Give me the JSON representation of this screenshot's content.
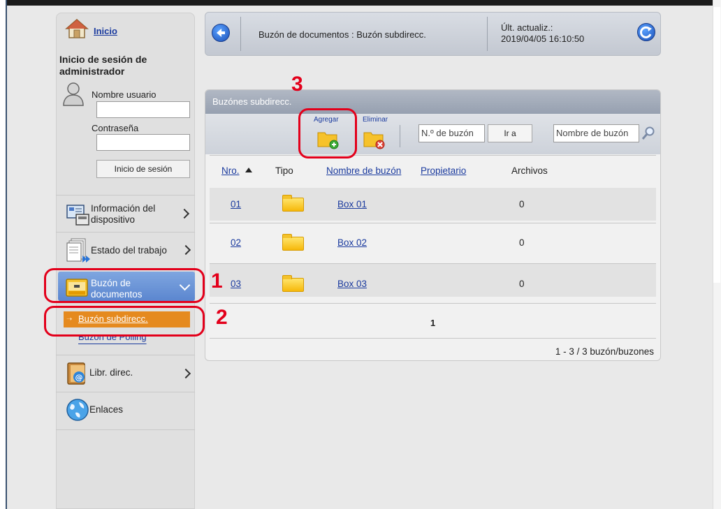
{
  "sidebar": {
    "home_link": "Inicio",
    "login_title": "Inicio de sesión de administrador",
    "username_label": "Nombre usuario",
    "password_label": "Contraseña",
    "login_button": "Inicio de sesión",
    "nav": {
      "device_info": "Información del dispositivo",
      "job_status": "Estado del trabajo",
      "document_box": "Buzón de documentos",
      "sub_box": "Buzón subdirecc.",
      "polling_box": "Buzón de Polling",
      "address_book": "Libr. direc.",
      "links": "Enlaces"
    }
  },
  "header": {
    "breadcrumb": "Buzón de documentos : Buzón subdirecc.",
    "last_update_label": "Últ. actualiz.:",
    "last_update_value": "2019/04/05 16:10:50"
  },
  "panel": {
    "title": "Buzónes subdirecc.",
    "add_label": "Agregar",
    "delete_label": "Eliminar",
    "box_number_placeholder": "N.º de buzón",
    "go_button": "Ir a",
    "box_name_placeholder": "Nombre de buzón",
    "columns": {
      "number": "Nro.",
      "type": "Tipo",
      "name": "Nombre de buzón",
      "owner": "Propietario",
      "files": "Archivos"
    },
    "rows": [
      {
        "number": "01",
        "name": "Box 01",
        "files": "0"
      },
      {
        "number": "02",
        "name": "Box 02",
        "files": "0"
      },
      {
        "number": "03",
        "name": "Box 03",
        "files": "0"
      }
    ],
    "page": "1",
    "summary": "1 - 3 / 3 buzón/buzones"
  },
  "annotations": {
    "step1": "1",
    "step2": "2",
    "step3": "3",
    "color": "#e3001b"
  },
  "colors": {
    "active_nav": "#5b86cf",
    "sub_nav": "#e58a1f",
    "link": "#1a3a9e"
  }
}
